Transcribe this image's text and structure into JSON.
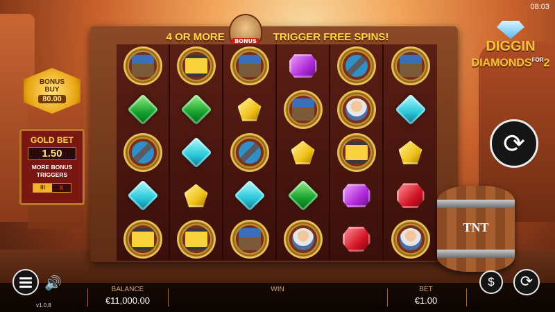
{
  "status": {
    "clock": "08:03"
  },
  "game": {
    "banner_left": "4 OR MORE",
    "banner_right": "TRIGGER FREE SPINS!",
    "bonus_badge": "BONUS",
    "logo_line1": "DIGGIN",
    "logo_for": "FOR",
    "logo_line2": "DIAMONDS",
    "logo_num": "2"
  },
  "bonus_buy": {
    "line1": "BONUS",
    "line2": "BUY",
    "value": "80.00"
  },
  "gold_bet": {
    "title": "GOLD BET",
    "value": "1.50",
    "subtitle_1": "MORE BONUS",
    "subtitle_2": "TRIGGERS",
    "toggle_on": "III",
    "toggle_off": "X"
  },
  "barrel": {
    "label": "TNT"
  },
  "reels": [
    [
      "cart",
      "green",
      "pickaxe",
      "cyan",
      "lantern"
    ],
    [
      "lantern",
      "green",
      "cyan",
      "yellow",
      "lantern"
    ],
    [
      "cart",
      "yellow",
      "pickaxe",
      "cyan",
      "cart"
    ],
    [
      "purple",
      "cart",
      "yellow",
      "green",
      "miner"
    ],
    [
      "pickaxe",
      "miner",
      "lantern",
      "purple",
      "red"
    ],
    [
      "cart",
      "cyan",
      "yellow",
      "red",
      "miner"
    ]
  ],
  "bottom_bar": {
    "balance_label": "BALANCE",
    "balance_value": "€11,000.00",
    "win_label": "WIN",
    "win_value": "",
    "bet_label": "BET",
    "bet_value": "€1.00"
  },
  "version": "v1.0.8",
  "icons": {
    "menu": "menu-icon",
    "sound": "speaker-icon",
    "spin": "spin-arrows-icon",
    "coin": "dollar-coin-icon",
    "autoplay": "autoplay-icon"
  }
}
